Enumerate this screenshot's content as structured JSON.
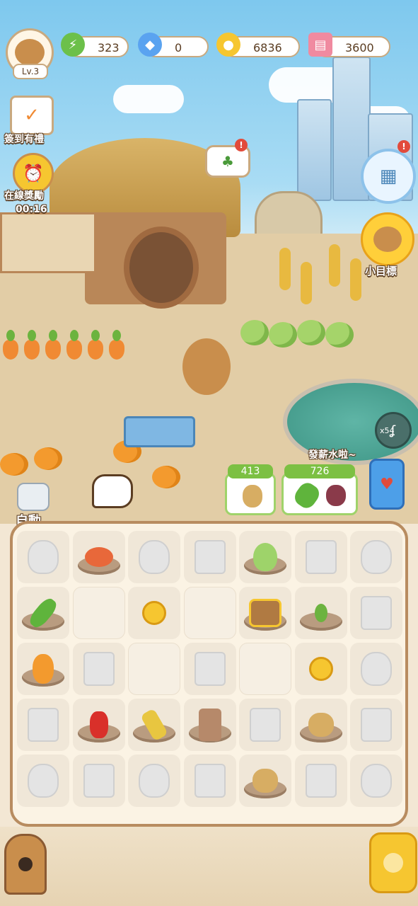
{
  "player": {
    "level": "Lv.3"
  },
  "resources": [
    {
      "id": "energy",
      "value": "323",
      "icon": "lightning-icon",
      "color": "#6cc04a"
    },
    {
      "id": "diamond",
      "value": "0",
      "icon": "diamond-icon",
      "color": "#5aa3f0"
    },
    {
      "id": "coin",
      "value": "6836",
      "icon": "coin-icon",
      "color": "#f6c630"
    },
    {
      "id": "ticket",
      "value": "3600",
      "icon": "ticket-icon",
      "color": "#f08aa0"
    }
  ],
  "left_menu": {
    "checkin_label": "簽到有禮",
    "online_label": "在線獎勵",
    "online_timer": "00:16"
  },
  "right_menu": {
    "goal_label": "小目標",
    "fishing_count": "x54"
  },
  "speech": {
    "salary": "發薪水啦~"
  },
  "orders": [
    {
      "price": "413",
      "items": [
        "potato"
      ]
    },
    {
      "price": "726",
      "items": [
        "cucumber",
        "dragon-fruit"
      ]
    }
  ],
  "auto_label": "自動",
  "board": {
    "rows": [
      [
        "bag",
        "crab",
        "bag",
        "box",
        "turnip",
        "box",
        "bag"
      ],
      [
        "cucumber",
        "empty",
        "coin",
        "empty",
        "basket",
        "sprout",
        "box"
      ],
      [
        "gourd",
        "box",
        "empty",
        "box",
        "empty",
        "coin",
        "bag"
      ],
      [
        "box",
        "pepper",
        "corn",
        "log",
        "box",
        "potato",
        "box"
      ],
      [
        "bag",
        "box",
        "bag",
        "box",
        "potato",
        "box",
        "bag"
      ]
    ]
  },
  "colors": {
    "accent": "#b88c60",
    "board_bg": "#fbf3e4",
    "hud_text": "#5b3d22"
  }
}
